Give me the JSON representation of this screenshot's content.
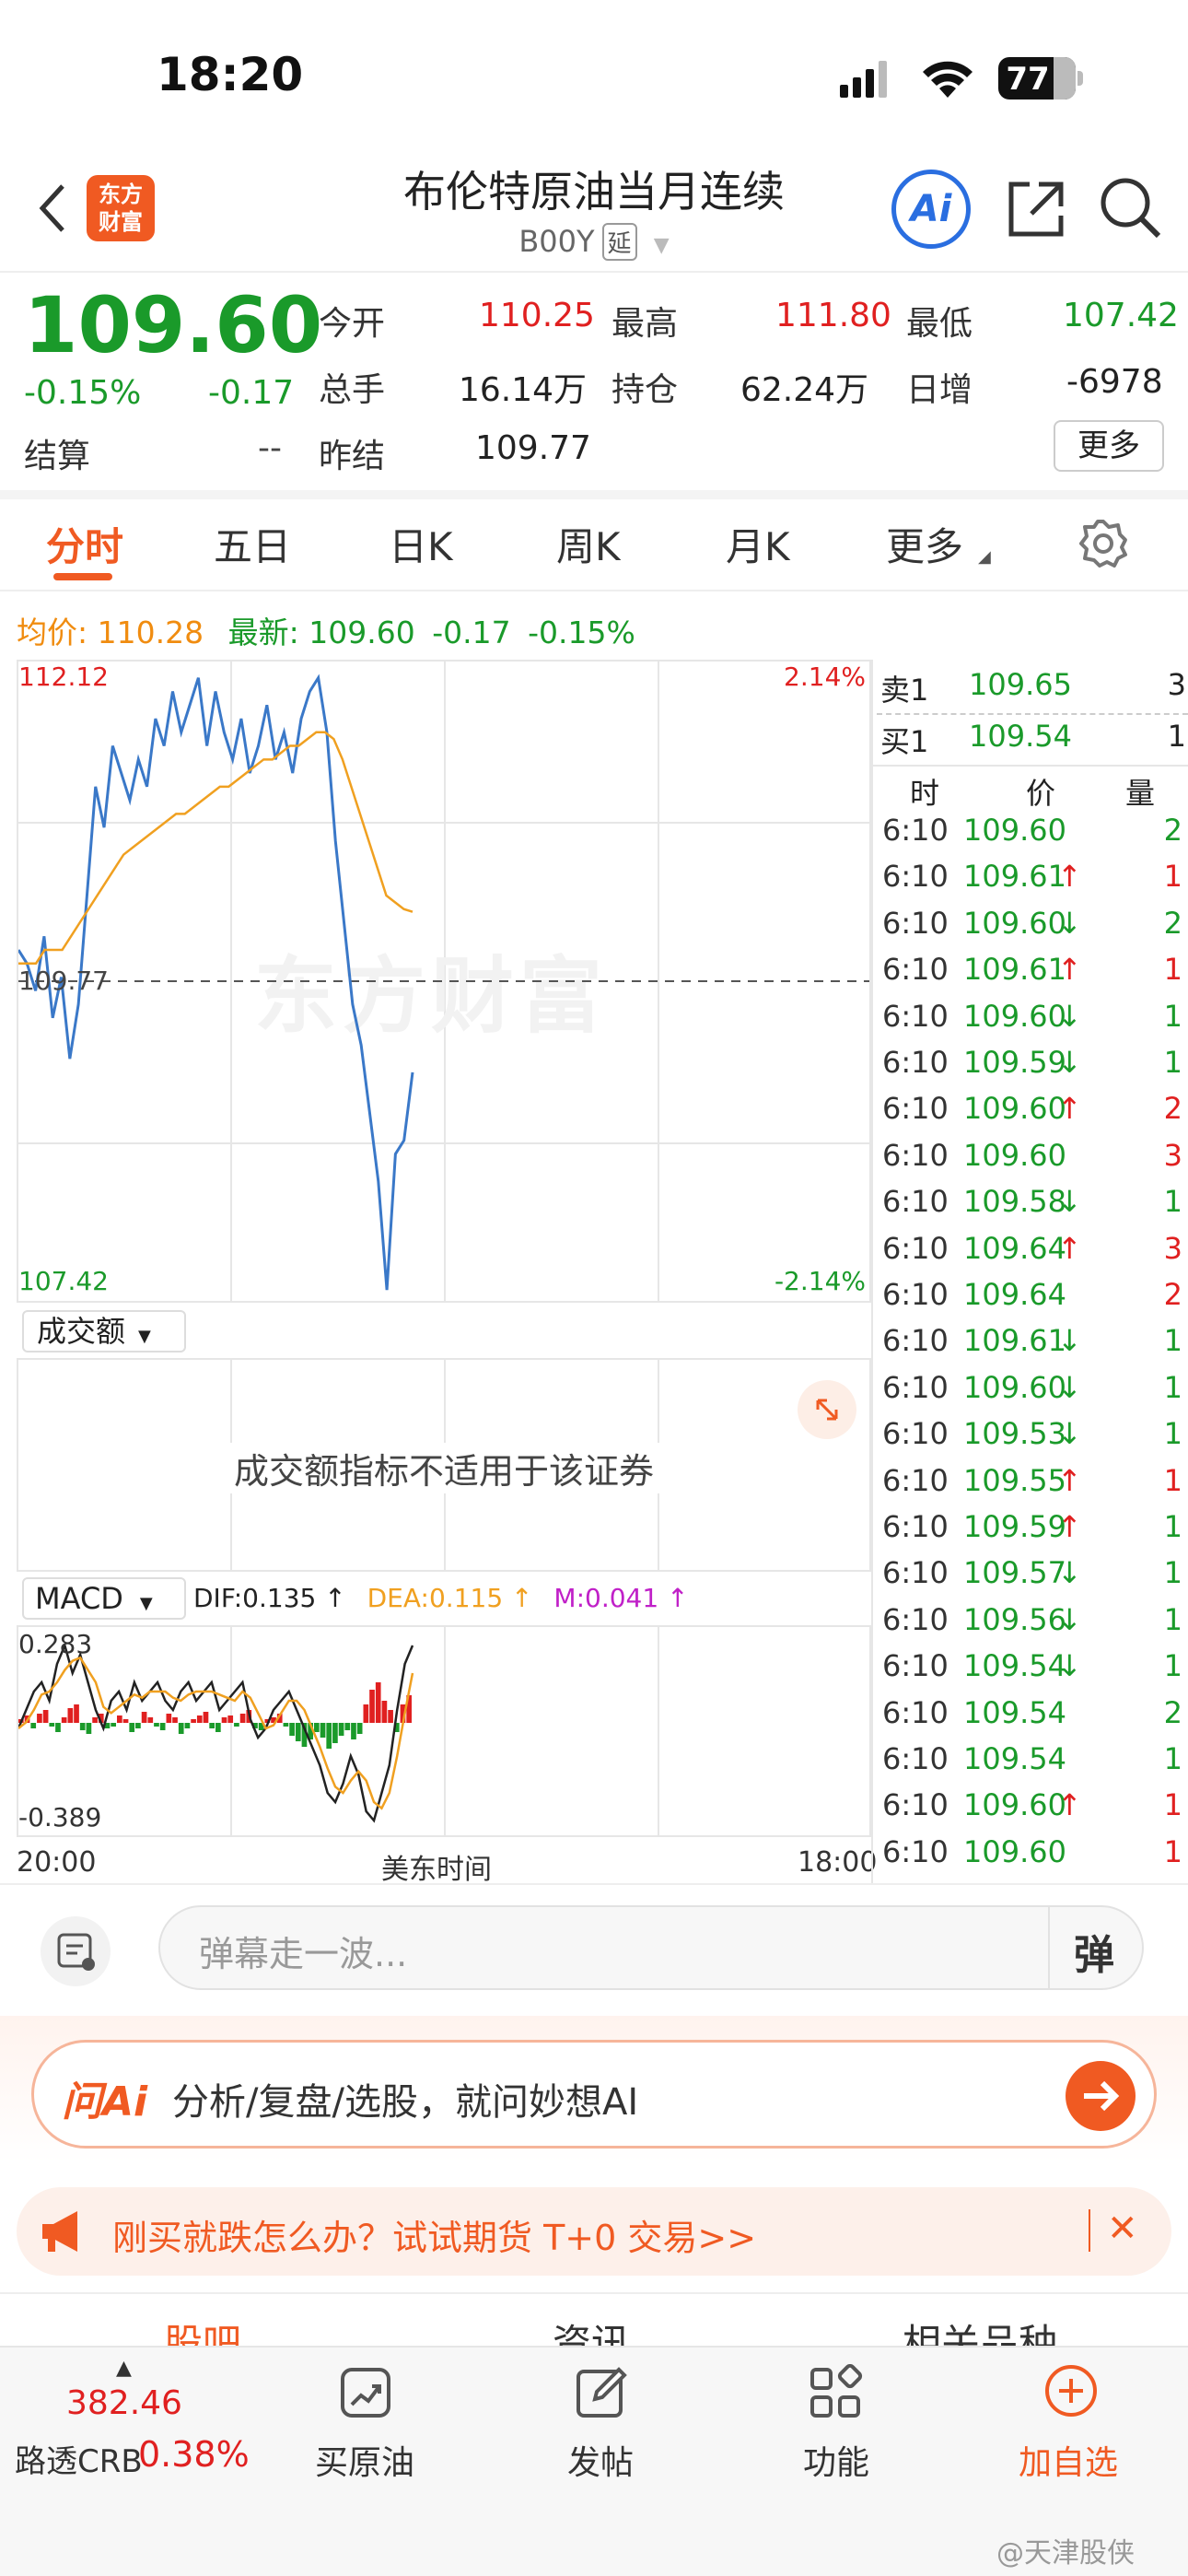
{
  "status_bar": {
    "time": "18:20",
    "battery": "77"
  },
  "header": {
    "title": "布伦特原油当月连续",
    "code": "B00Y",
    "delay_badge": "延",
    "logo_line1": "东方",
    "logo_line2": "财富",
    "ai_icon_label": "Ai"
  },
  "quote": {
    "price": "109.60",
    "change_pct": "-0.15%",
    "change": "-0.17",
    "settle_label": "结算",
    "settle_value": "--",
    "open_label": "今开",
    "open_value": "110.25",
    "volume_label": "总手",
    "volume_value": "16.14万",
    "prev_settle_label": "昨结",
    "prev_settle_value": "109.77",
    "high_label": "最高",
    "high_value": "111.80",
    "oi_label": "持仓",
    "oi_value": "62.24万",
    "low_label": "最低",
    "low_value": "107.42",
    "daily_inc_label": "日增",
    "daily_inc_value": "-6978",
    "more_button": "更多"
  },
  "tabs": [
    {
      "label": "分时",
      "active": true
    },
    {
      "label": "五日",
      "active": false
    },
    {
      "label": "日K",
      "active": false
    },
    {
      "label": "周K",
      "active": false
    },
    {
      "label": "月K",
      "active": false
    },
    {
      "label": "更多",
      "active": false
    }
  ],
  "info_line": {
    "avg_label": "均价:",
    "avg_value": "110.28",
    "latest_label": "最新:",
    "latest_value": "109.60",
    "latest_change": "-0.17",
    "latest_pct": "-0.15%"
  },
  "chart_labels": {
    "y_top": "112.12",
    "y_mid": "109.77",
    "y_bottom": "107.42",
    "pct_top": "2.14%",
    "pct_bottom": "-2.14%",
    "watermark": "东方财富"
  },
  "chart_data": {
    "type": "line",
    "ylim": [
      107.42,
      112.12
    ],
    "reference": 109.77,
    "series": [
      {
        "name": "最新",
        "color": "#3a78c8",
        "values": [
          110.0,
          109.9,
          109.7,
          110.1,
          109.5,
          109.8,
          109.2,
          109.6,
          110.4,
          111.2,
          110.9,
          111.5,
          111.3,
          111.1,
          111.4,
          111.2,
          111.7,
          111.5,
          111.9,
          111.6,
          111.8,
          112.0,
          111.5,
          111.9,
          111.6,
          111.4,
          111.7,
          111.3,
          111.5,
          111.8,
          111.4,
          111.6,
          111.3,
          111.7,
          111.9,
          112.0,
          111.6,
          110.8,
          110.2,
          109.6,
          109.3,
          108.8,
          108.3,
          107.5,
          108.5,
          108.6,
          109.1
        ]
      },
      {
        "name": "均价",
        "color": "#f0a020",
        "values": [
          109.9,
          109.9,
          109.9,
          110.0,
          110.0,
          110.0,
          110.1,
          110.2,
          110.3,
          110.4,
          110.5,
          110.6,
          110.7,
          110.75,
          110.8,
          110.85,
          110.9,
          110.95,
          111.0,
          111.0,
          111.05,
          111.1,
          111.15,
          111.2,
          111.2,
          111.25,
          111.3,
          111.35,
          111.4,
          111.4,
          111.45,
          111.5,
          111.5,
          111.55,
          111.6,
          111.6,
          111.55,
          111.4,
          111.2,
          111.0,
          110.8,
          110.6,
          110.4,
          110.35,
          110.3,
          110.28
        ]
      }
    ],
    "xlabels": [
      "20:00",
      "美东时间",
      "18:00"
    ]
  },
  "volume_panel": {
    "selector": "成交额",
    "message": "成交额指标不适用于该证券"
  },
  "macd": {
    "selector": "MACD",
    "dif": "DIF:0.135",
    "dea": "DEA:0.115",
    "m": "M:0.041",
    "top": "0.283",
    "bottom": "-0.389"
  },
  "order_book": {
    "sell_label": "卖1",
    "sell_price": "109.65",
    "sell_qty": "3",
    "buy_label": "买1",
    "buy_price": "109.54",
    "buy_qty": "1",
    "col_time": "时",
    "col_price": "价",
    "col_qty": "量"
  },
  "trades": [
    {
      "time": "6:10",
      "price": "109.60",
      "arrow": "",
      "qty": "2",
      "qcolor": "#1a9a2a"
    },
    {
      "time": "6:10",
      "price": "109.61",
      "arrow": "↑",
      "qty": "1",
      "qcolor": "#e02020"
    },
    {
      "time": "6:10",
      "price": "109.60",
      "arrow": "↓",
      "qty": "2",
      "qcolor": "#1a9a2a"
    },
    {
      "time": "6:10",
      "price": "109.61",
      "arrow": "↑",
      "qty": "1",
      "qcolor": "#e02020"
    },
    {
      "time": "6:10",
      "price": "109.60",
      "arrow": "↓",
      "qty": "1",
      "qcolor": "#1a9a2a"
    },
    {
      "time": "6:10",
      "price": "109.59",
      "arrow": "↓",
      "qty": "1",
      "qcolor": "#1a9a2a"
    },
    {
      "time": "6:10",
      "price": "109.60",
      "arrow": "↑",
      "qty": "2",
      "qcolor": "#e02020"
    },
    {
      "time": "6:10",
      "price": "109.60",
      "arrow": "",
      "qty": "3",
      "qcolor": "#e02020"
    },
    {
      "time": "6:10",
      "price": "109.58",
      "arrow": "↓",
      "qty": "1",
      "qcolor": "#1a9a2a"
    },
    {
      "time": "6:10",
      "price": "109.64",
      "arrow": "↑",
      "qty": "3",
      "qcolor": "#e02020"
    },
    {
      "time": "6:10",
      "price": "109.64",
      "arrow": "",
      "qty": "2",
      "qcolor": "#e02020"
    },
    {
      "time": "6:10",
      "price": "109.61",
      "arrow": "↓",
      "qty": "1",
      "qcolor": "#1a9a2a"
    },
    {
      "time": "6:10",
      "price": "109.60",
      "arrow": "↓",
      "qty": "1",
      "qcolor": "#1a9a2a"
    },
    {
      "time": "6:10",
      "price": "109.53",
      "arrow": "↓",
      "qty": "1",
      "qcolor": "#1a9a2a"
    },
    {
      "time": "6:10",
      "price": "109.55",
      "arrow": "↑",
      "qty": "1",
      "qcolor": "#e02020"
    },
    {
      "time": "6:10",
      "price": "109.59",
      "arrow": "↑",
      "qty": "1",
      "qcolor": "#1a9a2a"
    },
    {
      "time": "6:10",
      "price": "109.57",
      "arrow": "↓",
      "qty": "1",
      "qcolor": "#1a9a2a"
    },
    {
      "time": "6:10",
      "price": "109.56",
      "arrow": "↓",
      "qty": "1",
      "qcolor": "#1a9a2a"
    },
    {
      "time": "6:10",
      "price": "109.54",
      "arrow": "↓",
      "qty": "1",
      "qcolor": "#1a9a2a"
    },
    {
      "time": "6:10",
      "price": "109.54",
      "arrow": "",
      "qty": "2",
      "qcolor": "#1a9a2a"
    },
    {
      "time": "6:10",
      "price": "109.54",
      "arrow": "",
      "qty": "1",
      "qcolor": "#1a9a2a"
    },
    {
      "time": "6:10",
      "price": "109.60",
      "arrow": "↑",
      "qty": "1",
      "qcolor": "#e02020"
    },
    {
      "time": "6:10",
      "price": "109.60",
      "arrow": "",
      "qty": "1",
      "qcolor": "#e02020"
    }
  ],
  "danmaku": {
    "placeholder": "弹幕走一波...",
    "toggle": "弹"
  },
  "ask_ai": {
    "brand": "问Ai",
    "prompt": "分析/复盘/选股，就问妙想AI"
  },
  "promo": {
    "text": "刚买就跌怎么办？试试期货 T+0 交易>>"
  },
  "section_tabs": [
    "股吧",
    "资讯",
    "相关品种"
  ],
  "bottom_bar": {
    "index_value": "382.46",
    "index_name": "路透CRB",
    "index_pct": "0.38%",
    "buy_oil": "买原油",
    "post": "发帖",
    "function": "功能",
    "add_watch": "加自选"
  },
  "weibo_watermark": "@天津股侠"
}
